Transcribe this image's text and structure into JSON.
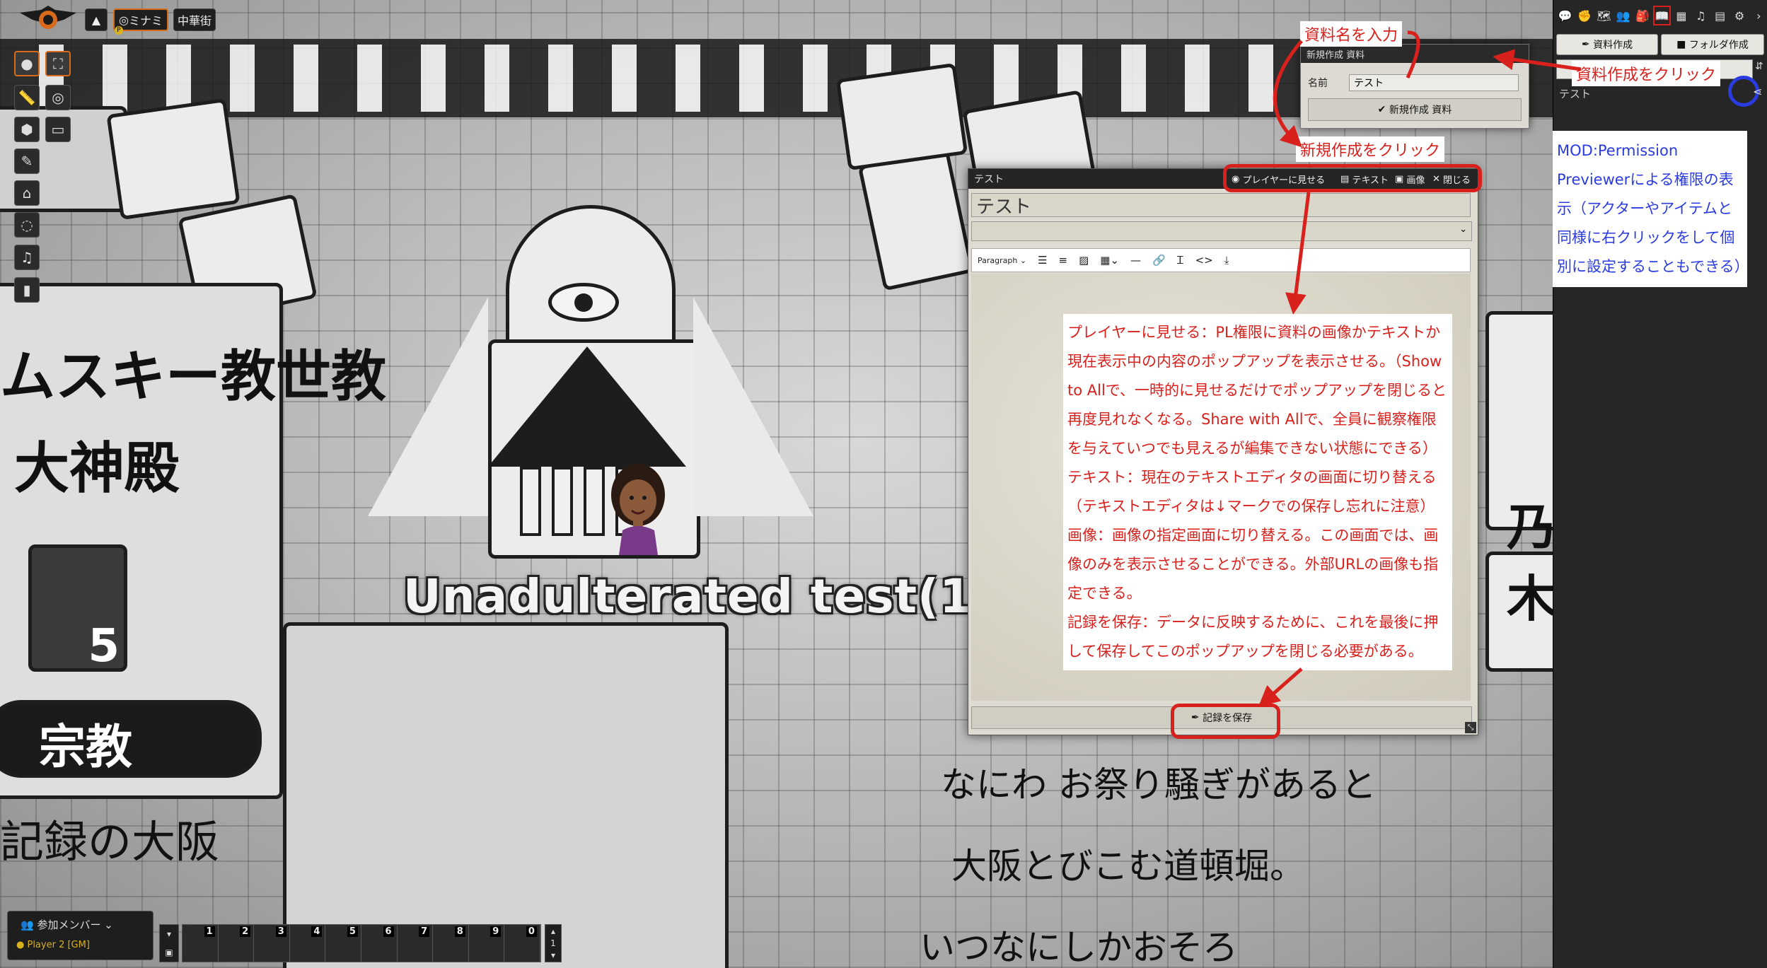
{
  "topbar": {
    "scene_active": "ミナミ",
    "scene_other": "中華街",
    "scene_badge": "P"
  },
  "map": {
    "vertical_text_1": "ムスキー教世教",
    "vertical_text_2": "大神殿",
    "door_number": "5",
    "religion_label": "宗教",
    "hand_text_left": "記録の大阪",
    "hand_text_right_1": "なにわ お祭り騒ぎがあると",
    "hand_text_right_2": "大阪とびこむ道頓堀。",
    "hand_text_right_3": "いつなにしかおそろ",
    "right_edge_text": "乃木",
    "token_label": "Unadulterated test(1)"
  },
  "sidebar": {
    "create_entry_label": "資料作成",
    "create_folder_label": "フォルダ作成",
    "entry_name": "テスト",
    "tab_icons": [
      "chat-icon",
      "combat-icon",
      "scenes-icon",
      "actors-icon",
      "items-icon",
      "journal-icon",
      "tables-icon",
      "playlists-icon",
      "compendium-icon",
      "settings-icon"
    ]
  },
  "create_dialog": {
    "title": "新規作成 資料",
    "name_label": "名前",
    "name_value": "テスト",
    "submit_label": "新規作成 資料"
  },
  "journal": {
    "window_title": "テスト",
    "show_players": "プレイヤーに見せる",
    "text_mode": "テキスト",
    "image_mode": "画像",
    "close": "閉じる",
    "name_value": "テスト",
    "format_select": "Paragraph",
    "save_label": "記録を保存"
  },
  "bottom": {
    "players_header": "参加メンバー",
    "player_name": "Player 2 [GM]",
    "hotbar_slots": [
      "1",
      "2",
      "3",
      "4",
      "5",
      "6",
      "7",
      "8",
      "9",
      "0"
    ],
    "hotbar_page": "1"
  },
  "annotations": {
    "enter_name": "資料名を入力",
    "click_create_entry": "資料作成をクリック",
    "click_new_create": "新規作成をクリック",
    "permission_note": "MOD:Permission Previewerによる権限の表示（アクターやアイテムと同様に右クリックをして個別に設定することもできる）",
    "explain_lines": [
      "プレイヤーに見せる：PL権限に資料の画像かテキストか現在表示中の内容のポップアップを表示させる。（Show to Allで、一時的に見せるだけでポップアップを閉じると再度見れなくなる。Share with Allで、全員に観察権限を与えていつでも見えるが編集できない状態にできる）",
      "テキスト：現在のテキストエディタの画面に切り替える（テキストエディタは↓マークでの保存し忘れに注意）",
      "画像：画像の指定画面に切り替える。この画面では、画像のみを表示させることができる。外部URLの画像も指定できる。",
      "記録を保存：データに反映するために、これを最後に押して保存してこのポップアップを閉じる必要がある。"
    ]
  },
  "colors": {
    "annotation_red": "#d8211d",
    "annotation_blue": "#2a3be0",
    "accent_orange": "#d86a1b"
  }
}
